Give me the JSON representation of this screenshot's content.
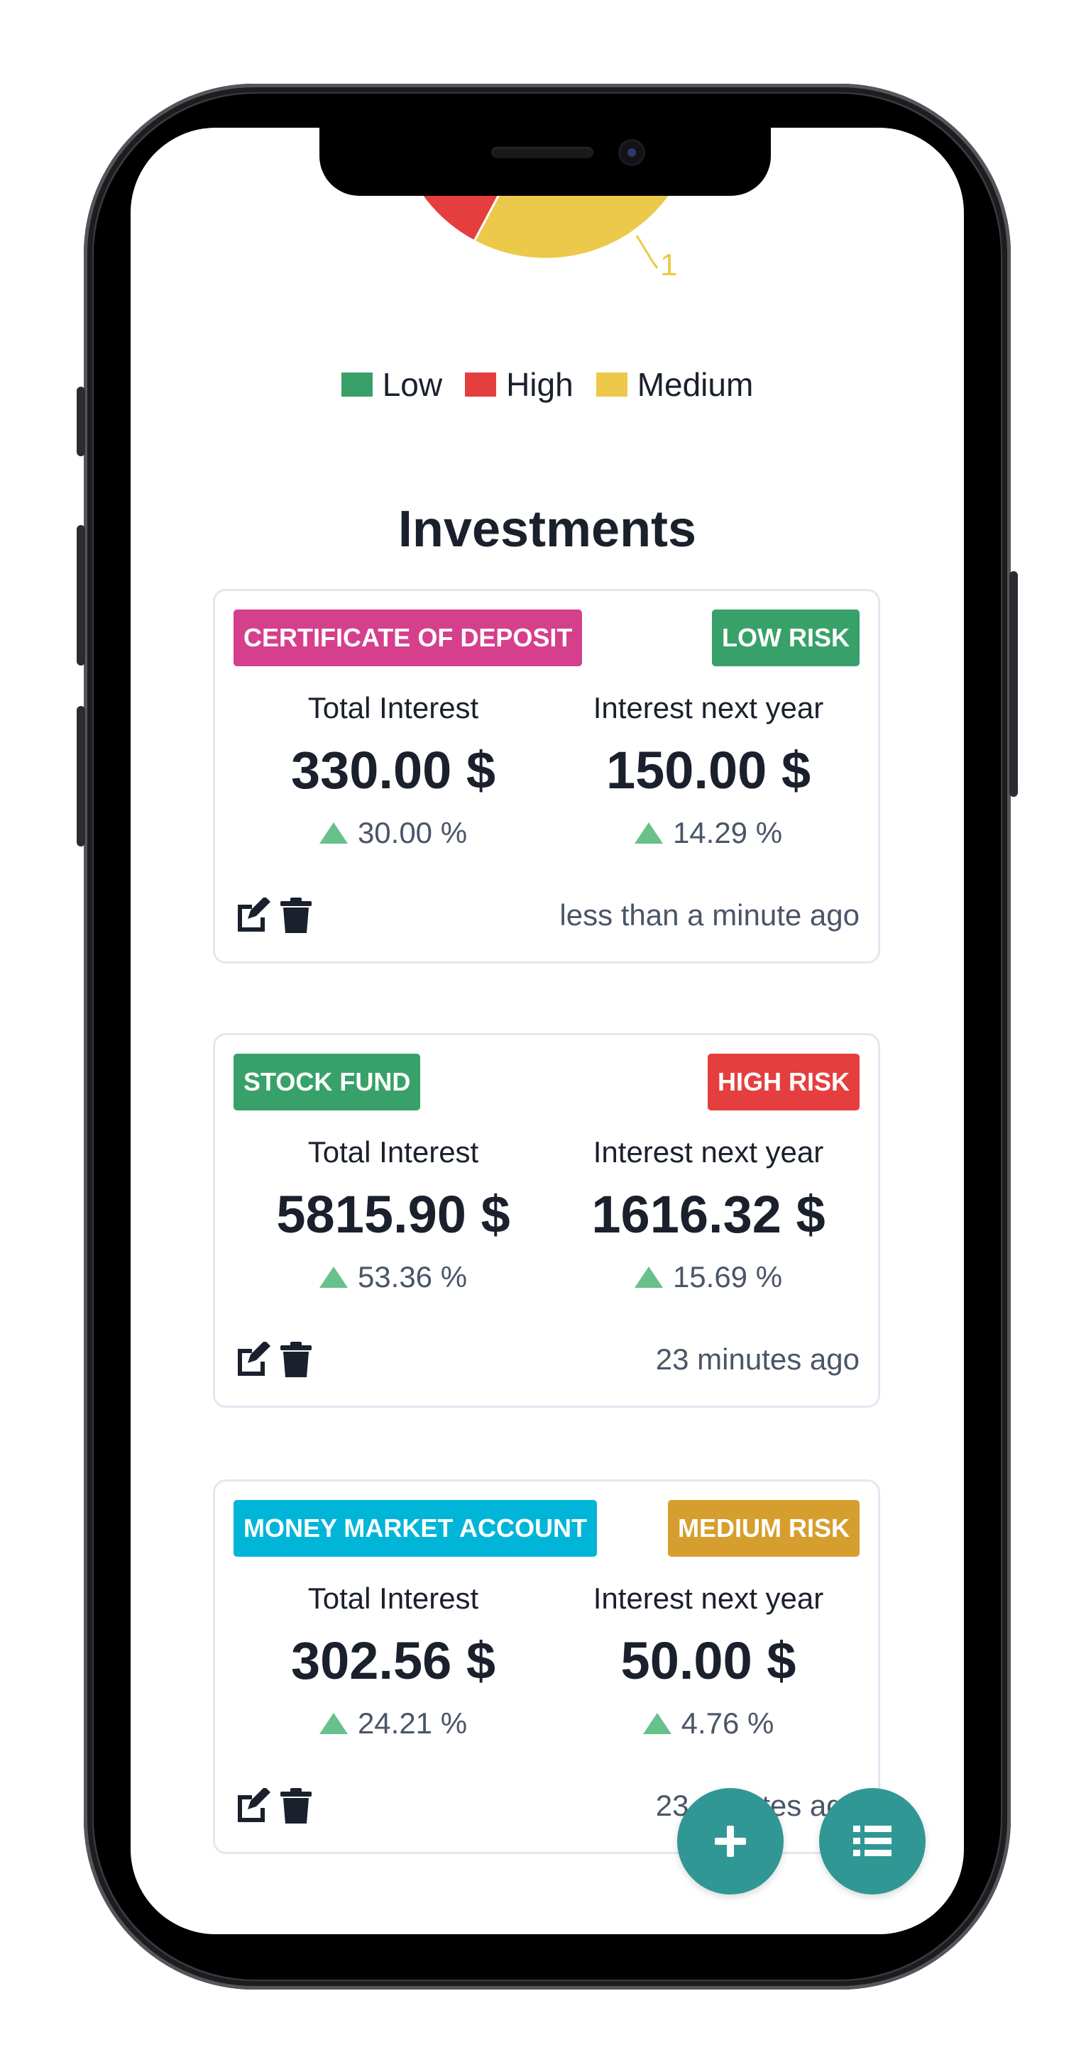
{
  "chart": {
    "type": "pie",
    "visible_data_label": "1",
    "colors": {
      "low": "#38a169",
      "high": "#e53e3e",
      "medium": "#ecc94b"
    }
  },
  "legend": [
    {
      "label": "Low",
      "color": "#38a169"
    },
    {
      "label": "High",
      "color": "#e53e3e"
    },
    {
      "label": "Medium",
      "color": "#ecc94b"
    }
  ],
  "page_title": "Investments",
  "investments": [
    {
      "type": "CERTIFICATE OF DEPOSIT",
      "type_color": "#d53f8c",
      "risk": "LOW RISK",
      "risk_color": "#38a169",
      "total_interest_label": "Total Interest",
      "total_interest": "330.00 $",
      "total_interest_change": "30.00 %",
      "next_year_label": "Interest next year",
      "next_year": "150.00 $",
      "next_year_change": "14.29 %",
      "updated": "less than a minute ago"
    },
    {
      "type": "STOCK FUND",
      "type_color": "#38a169",
      "risk": "HIGH RISK",
      "risk_color": "#e53e3e",
      "total_interest_label": "Total Interest",
      "total_interest": "5815.90 $",
      "total_interest_change": "53.36 %",
      "next_year_label": "Interest next year",
      "next_year": "1616.32 $",
      "next_year_change": "15.69 %",
      "updated": "23 minutes ago"
    },
    {
      "type": "MONEY MARKET ACCOUNT",
      "type_color": "#00b5d8",
      "risk": "MEDIUM RISK",
      "risk_color": "#d69e2e",
      "total_interest_label": "Total Interest",
      "total_interest": "302.56 $",
      "total_interest_change": "24.21 %",
      "next_year_label": "Interest next year",
      "next_year": "50.00 $",
      "next_year_change": "4.76 %",
      "updated": "23 minutes ago"
    }
  ],
  "icons": {
    "edit": "edit-icon",
    "delete": "trash-icon",
    "add": "plus-icon",
    "list": "list-icon"
  },
  "accent_color": "#319795"
}
